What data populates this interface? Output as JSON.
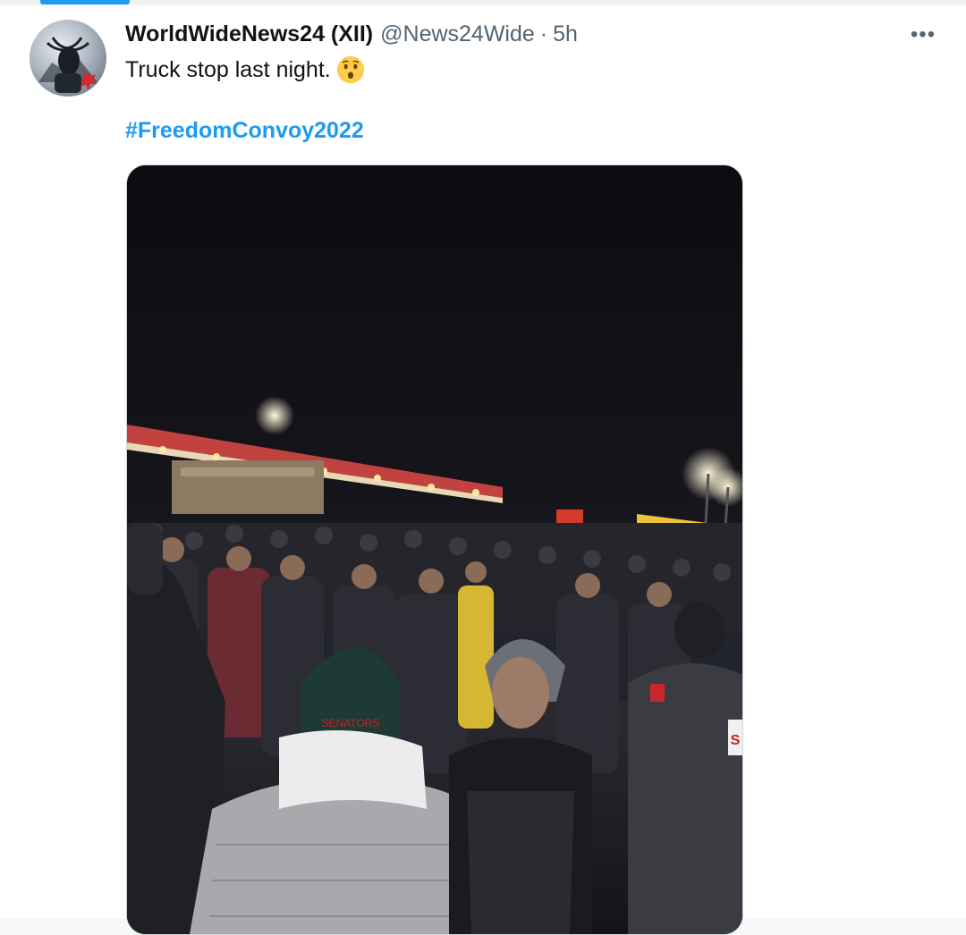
{
  "tweet": {
    "display_name": "WorldWideNews24 (XII)",
    "handle": "@News24Wide",
    "separator": "·",
    "timestamp": "5h",
    "more": "•••",
    "text": "Truck stop last night.",
    "emoji": "hushed-face-emoji",
    "hashtag": "#FreedomConvoy2022",
    "media": {
      "sign_fragment": "S"
    }
  },
  "colors": {
    "accent": "#1d9bf0",
    "text": "#0f1419",
    "secondary": "#536471"
  }
}
